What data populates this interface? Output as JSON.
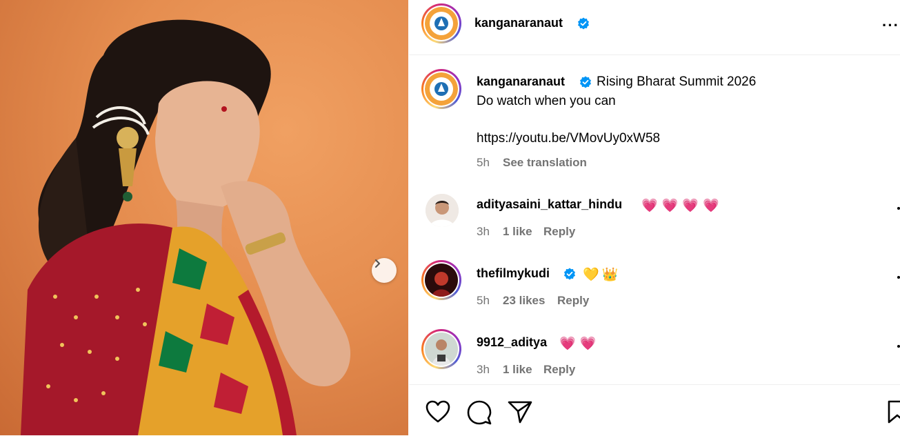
{
  "post": {
    "username": "kanganaranaut",
    "more_label": "···"
  },
  "caption": {
    "username": "kanganaranaut",
    "line1": "Rising Bharat Summit 2026",
    "line2": "Do watch when you can",
    "url": "https://youtu.be/VMovUy0xW58",
    "time": "5h",
    "translate": "See translation"
  },
  "comments": [
    {
      "username": "adityasaini_kattar_hindu",
      "emoji": "💗💗💗💗",
      "time": "3h",
      "likes": "1 like",
      "reply": "Reply"
    },
    {
      "username": "thefilmykudi",
      "emoji": "💛👑",
      "time": "5h",
      "likes": "23 likes",
      "reply": "Reply"
    },
    {
      "username": "9912_aditya",
      "emoji": "💗💗",
      "time": "3h",
      "likes": "1 like",
      "reply": "Reply"
    }
  ],
  "colors": {
    "verified": "#0095f6",
    "muted": "#737373",
    "heart": "#ff3040",
    "photo_background": "#e58d4f"
  },
  "icons": {
    "like": "heart-icon",
    "comment": "comment-icon",
    "share": "send-icon",
    "save": "bookmark-icon",
    "next": "chevron-right-icon"
  }
}
